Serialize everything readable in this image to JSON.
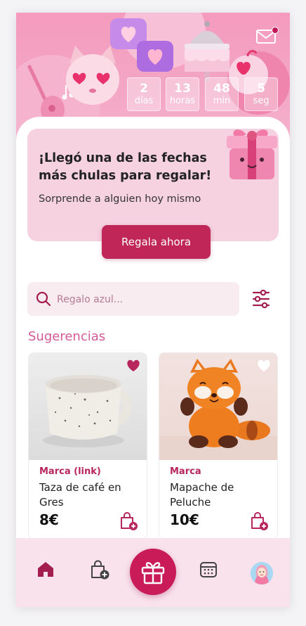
{
  "countdown": [
    {
      "value": "2",
      "unit": "días"
    },
    {
      "value": "13",
      "unit": "horas"
    },
    {
      "value": "48",
      "unit": "min"
    },
    {
      "value": "5",
      "unit": "seg"
    }
  ],
  "promo": {
    "title": "¡Llegó una de las fechas más chulas para regalar!",
    "subtitle": "Sorprende a alguien hoy mismo",
    "cta_label": "Regala ahora"
  },
  "search": {
    "placeholder": "Regalo azul..."
  },
  "suggestions": {
    "title": "Sugerencias",
    "items": [
      {
        "brand": "Marca (link)",
        "name": "Taza de café en Gres",
        "price": "8€",
        "favorited": true
      },
      {
        "brand": "Marca",
        "name": "Mapache de Peluche",
        "price": "10€",
        "favorited": false
      }
    ]
  },
  "tabbar": {
    "items": [
      "home-icon",
      "add-to-bag-icon",
      "gift-icon",
      "calendar-icon",
      "profile-avatar"
    ]
  },
  "colors": {
    "accent": "#c02658",
    "hero_pink": "#f59bbd",
    "promo_bg": "#f6d1e0",
    "section_title": "#d45b98",
    "tabbar_bg": "#f9e2ec"
  }
}
